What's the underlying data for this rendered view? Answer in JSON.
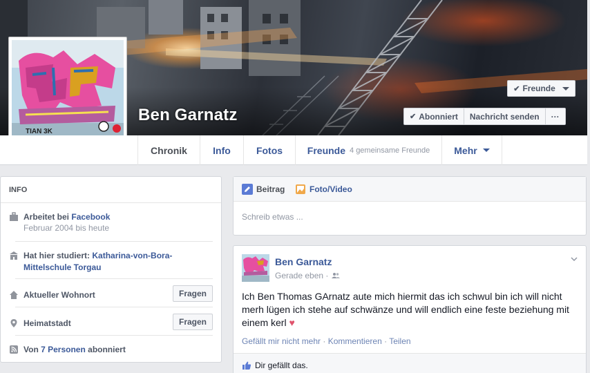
{
  "profile": {
    "name": "Ben Garnatz"
  },
  "header_buttons": {
    "friends": "Freunde",
    "subscribed": "Abonniert",
    "message": "Nachricht senden",
    "more": "···"
  },
  "nav": {
    "timeline": "Chronik",
    "info": "Info",
    "photos": "Fotos",
    "friends": "Freunde",
    "friends_sub": "4 gemeinsame Freunde",
    "more": "Mehr"
  },
  "info": {
    "heading": "INFO",
    "work_prefix": "Arbeitet bei ",
    "work_link": "Facebook",
    "work_dates": "Februar 2004 bis heute",
    "study_prefix": "Hat hier studiert: ",
    "study_link_line1": "Katharina-von-Bora-",
    "study_link_line2": "Mittelschule Torgau",
    "current_city": "Aktueller Wohnort",
    "hometown": "Heimatstadt",
    "ask_label": "Fragen",
    "followers_prefix": "Von ",
    "followers_link": "7 Personen",
    "followers_suffix": " abonniert"
  },
  "composer": {
    "tab_post": "Beitrag",
    "tab_photo": "Foto/Video",
    "placeholder": "Schreib etwas ..."
  },
  "post": {
    "author": "Ben Garnatz",
    "time": "Gerade eben · ",
    "text": "Ich Ben Thomas GArnatz aute mich hiermit das ich schwul bin ich will nicht merh lügen ich stehe auf schwänze und will endlich eine feste beziehung mit einem kerl",
    "heart": "♥",
    "action_like": "Gefällt mir nicht mehr",
    "sep1": " · ",
    "action_comment": "Kommentieren",
    "sep2": " · ",
    "action_share": "Teilen",
    "likes_text": "Dir gefällt das."
  },
  "colors": {
    "brand": "#3b5998",
    "background": "#e9eaed",
    "heart": "#e0546d"
  }
}
